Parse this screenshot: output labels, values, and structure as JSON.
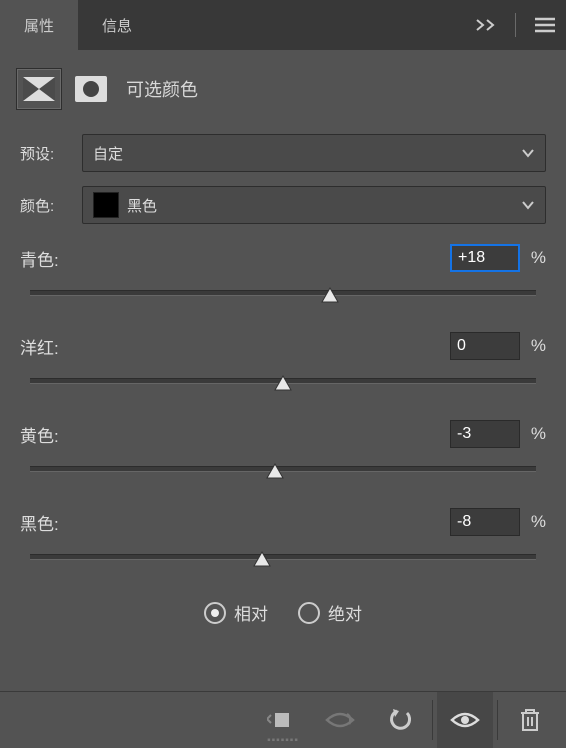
{
  "tabs": {
    "properties": "属性",
    "info": "信息"
  },
  "title": "可选颜色",
  "preset": {
    "label": "预设:",
    "value": "自定"
  },
  "color": {
    "label": "颜色:",
    "value": "黑色"
  },
  "sliders": {
    "cyan": {
      "label": "青色:",
      "value": "+18",
      "pos": 59,
      "active": true
    },
    "magenta": {
      "label": "洋红:",
      "value": "0",
      "pos": 50,
      "active": false
    },
    "yellow": {
      "label": "黄色:",
      "value": "-3",
      "pos": 48.5,
      "active": false
    },
    "black": {
      "label": "黑色:",
      "value": "-8",
      "pos": 46,
      "active": false
    }
  },
  "radios": {
    "relative": "相对",
    "absolute": "绝对",
    "selected": "relative"
  },
  "pct": "%"
}
